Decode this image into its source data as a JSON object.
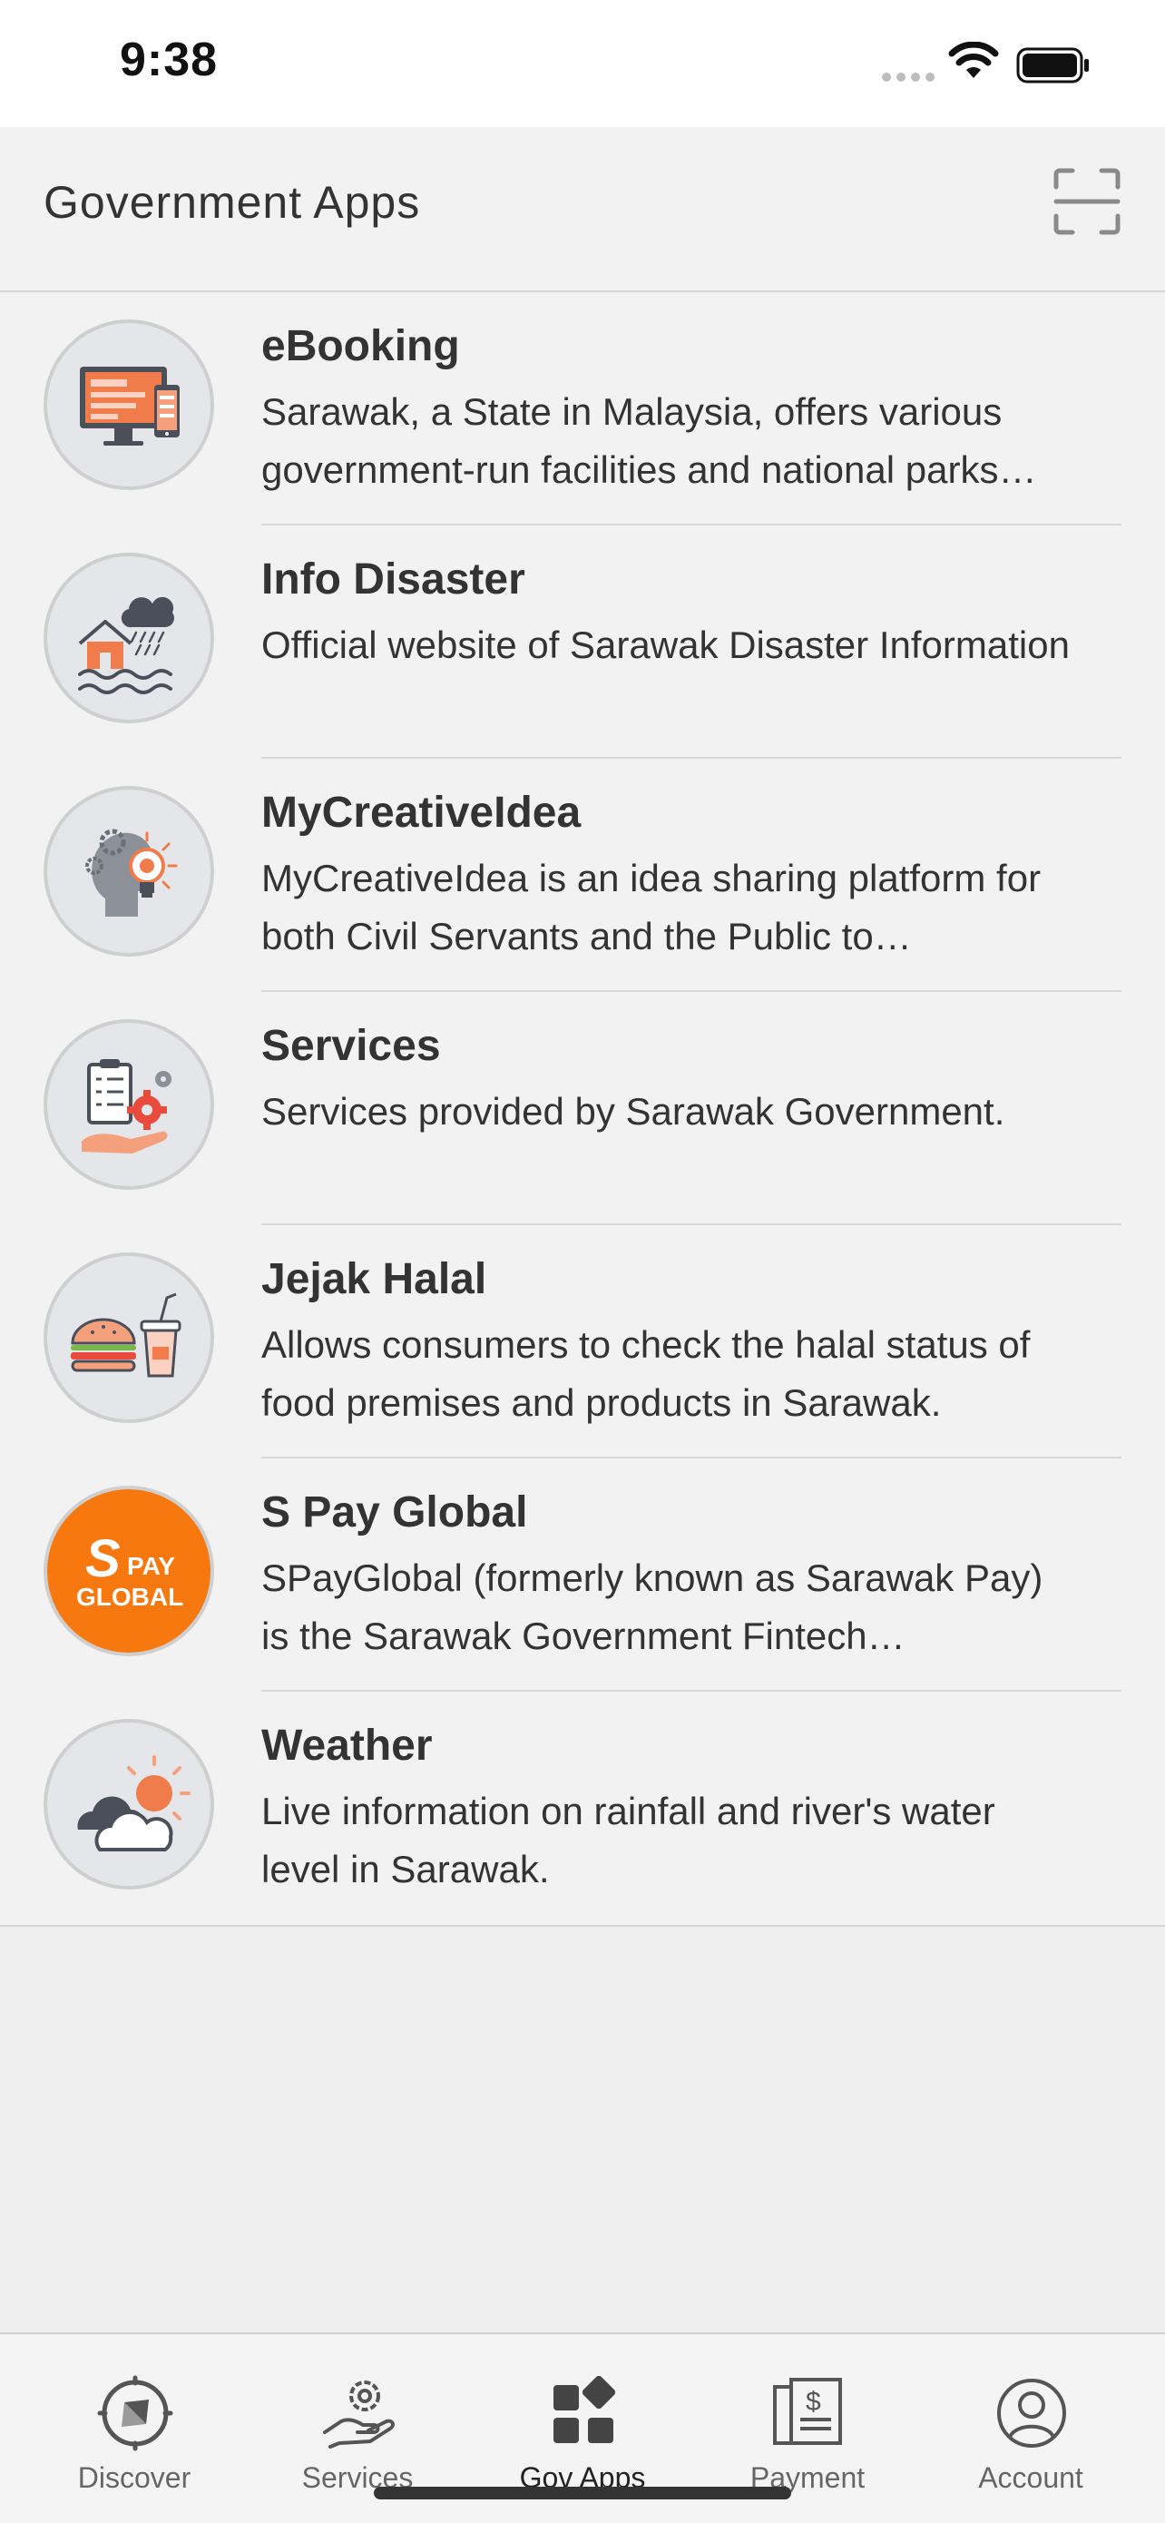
{
  "status_bar": {
    "time": "9:38"
  },
  "header": {
    "title": "Government Apps",
    "scan_icon": "scan-frame-icon"
  },
  "apps": [
    {
      "name": "eBooking",
      "description": "Sarawak, a State in Malaysia, offers various government-run facilities and national parks…",
      "icon": "monitor-phone-icon"
    },
    {
      "name": "Info Disaster",
      "description": "Official website of Sarawak Disaster Information",
      "icon": "flood-house-icon"
    },
    {
      "name": "MyCreativeIdea",
      "description": "MyCreativeIdea is an idea sharing platform for both Civil Servants and the Public to…",
      "icon": "head-lightbulb-icon"
    },
    {
      "name": "Services",
      "description": "Services provided by Sarawak Government.",
      "icon": "clipboard-gear-icon"
    },
    {
      "name": "Jejak Halal",
      "description": "Allows consumers to check the halal status of food premises and products in Sarawak.",
      "icon": "burger-drink-icon"
    },
    {
      "name": "S Pay Global",
      "description": "SPayGlobal (formerly known as Sarawak Pay) is the Sarawak Government Fintech…",
      "icon": "spay-logo-icon",
      "logo_text": "S PAY GLOBAL"
    },
    {
      "name": "Weather",
      "description": "Live information on rainfall and river's water level in Sarawak.",
      "icon": "cloud-sun-icon"
    }
  ],
  "tabs": [
    {
      "label": "Discover",
      "icon": "compass-icon"
    },
    {
      "label": "Services",
      "icon": "hand-gear-icon"
    },
    {
      "label": "Gov Apps",
      "icon": "grid-apps-icon",
      "active": true
    },
    {
      "label": "Payment",
      "icon": "bill-dollar-icon"
    },
    {
      "label": "Account",
      "icon": "user-circle-icon"
    }
  ],
  "colors": {
    "spay_orange": "#f7780f",
    "accent_orange": "#f07b4b"
  }
}
